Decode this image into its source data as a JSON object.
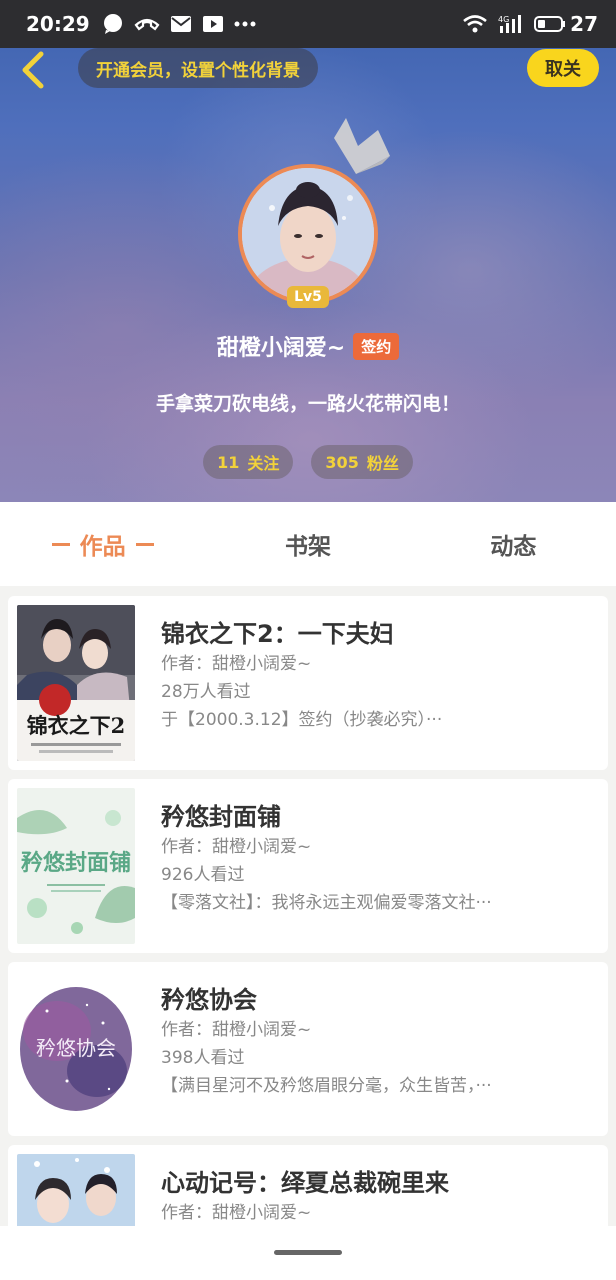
{
  "status_bar": {
    "time": "20:29",
    "battery": "27",
    "icons": [
      "chat-bubble-icon",
      "phone-icon",
      "mail-icon",
      "play-icon",
      "more-dots-icon",
      "wifi-icon",
      "signal-icon",
      "battery-icon"
    ],
    "network_label": "4G"
  },
  "header": {
    "back_icon": "back-arrow-icon",
    "vip_prompt": "开通会员，设置个性化背景",
    "close_label": "取关",
    "level": "Lv5",
    "username": "甜橙小阔爱~",
    "signed_badge": "签约",
    "bio": "手拿菜刀砍电线，一路火花带闪电！",
    "stats": [
      {
        "count": "11",
        "label": "关注"
      },
      {
        "count": "305",
        "label": "粉丝"
      }
    ]
  },
  "tabs": [
    {
      "label": "作品",
      "active": true
    },
    {
      "label": "书架",
      "active": false
    },
    {
      "label": "动态",
      "active": false
    }
  ],
  "books": [
    {
      "title": "锦衣之下2：一下夫妇",
      "author": "作者：甜橙小阔爱~",
      "views": "28万人看过",
      "desc": "于【2000.3.12】签约（抄袭必究）···",
      "cover_text": "锦衣之下2"
    },
    {
      "title": "矜悠封面铺",
      "author": "作者：甜橙小阔爱~",
      "views": "926人看过",
      "desc": "【零落文社】：我将永远主观偏爱零落文社···",
      "cover_text": "矜悠封面铺"
    },
    {
      "title": "矜悠协会",
      "author": "作者：甜橙小阔爱~",
      "views": "398人看过",
      "desc": "【满目星河不及矜悠眉眼分毫，众生皆苦，···",
      "cover_text": "矜悠协会"
    },
    {
      "title": "心动记号：绎夏总裁碗里来",
      "author": "作者：甜橙小阔爱~",
      "views": "",
      "desc": "",
      "cover_text": ""
    }
  ],
  "colors": {
    "accent": "#ec8a55",
    "vip_yellow": "#f2d23a",
    "close_btn": "#f9d51d",
    "signed_badge": "#ec6a3a"
  }
}
